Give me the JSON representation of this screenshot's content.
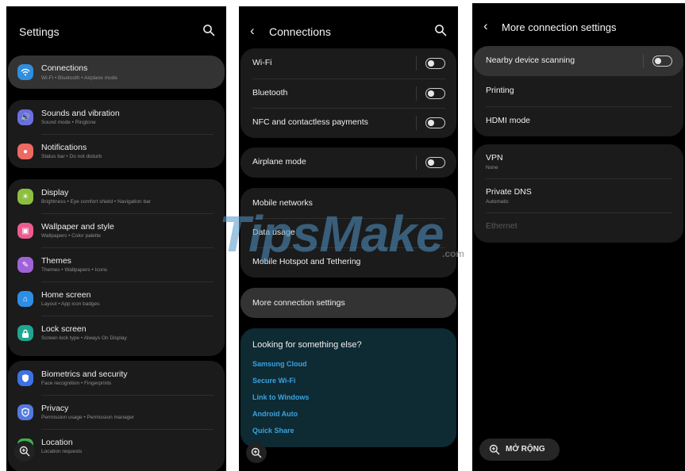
{
  "watermark": {
    "brand": "TipsMake",
    "suffix": ".com"
  },
  "screen_settings": {
    "title": "Settings",
    "items": [
      {
        "label": "Connections",
        "sub": "Wi-Fi  •  Bluetooth  •  Airplane mode",
        "color": "#2f8ee0"
      },
      {
        "label": "Sounds and vibration",
        "sub": "Sound mode  •  Ringtone",
        "color": "#6b6fe0"
      },
      {
        "label": "Notifications",
        "sub": "Status bar  •  Do not disturb",
        "color": "#ec6a62"
      },
      {
        "label": "Display",
        "sub": "Brightness  •  Eye comfort shield  •  Navigation bar",
        "color": "#8cbf3f"
      },
      {
        "label": "Wallpaper and style",
        "sub": "Wallpapers  •  Color palette",
        "color": "#ec5c8f"
      },
      {
        "label": "Themes",
        "sub": "Themes  •  Wallpapers  •  Icons",
        "color": "#a062d8"
      },
      {
        "label": "Home screen",
        "sub": "Layout  •  App icon badges",
        "color": "#2d8ee6"
      },
      {
        "label": "Lock screen",
        "sub": "Screen lock type  •  Always On Display",
        "color": "#1fa692"
      },
      {
        "label": "Biometrics and security",
        "sub": "Face recognition  •  Fingerprints",
        "color": "#3c72e6"
      },
      {
        "label": "Privacy",
        "sub": "Permission usage  •  Permission manager",
        "color": "#5479e0"
      },
      {
        "label": "Location",
        "sub": "Location requests",
        "color": "#3bb24b"
      }
    ]
  },
  "screen_connections": {
    "title": "Connections",
    "toggles": [
      {
        "label": "Wi-Fi"
      },
      {
        "label": "Bluetooth"
      },
      {
        "label": "NFC and contactless payments"
      },
      {
        "label": "Airplane mode"
      }
    ],
    "items": [
      {
        "label": "Mobile networks"
      },
      {
        "label": "Data usage"
      },
      {
        "label": "Mobile Hotspot and Tethering"
      }
    ],
    "more": {
      "label": "More connection settings"
    },
    "suggest": {
      "heading": "Looking for something else?",
      "links": [
        "Samsung Cloud",
        "Secure Wi-Fi",
        "Link to Windows",
        "Android Auto",
        "Quick Share"
      ]
    }
  },
  "screen_more": {
    "title": "More connection settings",
    "group1": [
      {
        "label": "Nearby device scanning"
      },
      {
        "label": "Printing"
      },
      {
        "label": "HDMI mode"
      }
    ],
    "group2": [
      {
        "label": "VPN",
        "sub": "None"
      },
      {
        "label": "Private DNS",
        "sub": "Automatic"
      },
      {
        "label": "Ethernet"
      }
    ],
    "zoom_label": "MỞ RỘNG"
  }
}
